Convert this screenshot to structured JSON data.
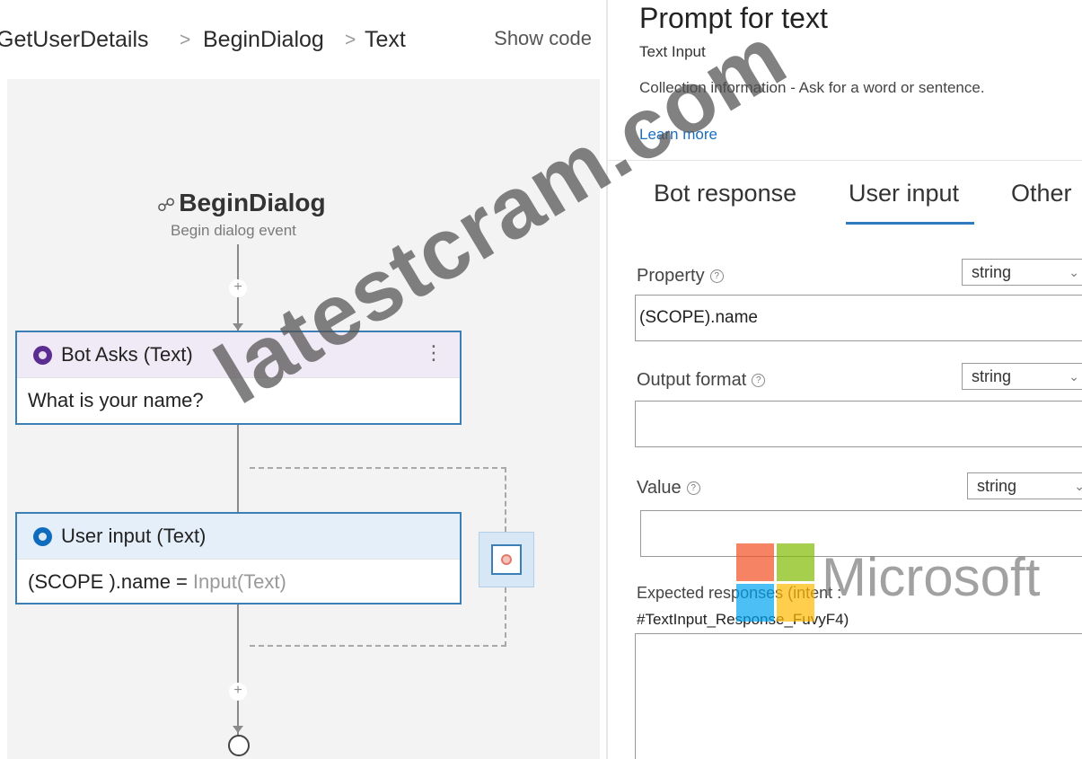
{
  "breadcrumb": {
    "items": [
      "GetUserDetails",
      "BeginDialog",
      "Text"
    ],
    "separator": ">",
    "show_code": "Show code"
  },
  "canvas": {
    "trigger": {
      "title": "BeginDialog",
      "subtitle": "Begin dialog event"
    },
    "add_symbol": "+",
    "bot_asks": {
      "title": "Bot Asks (Text)",
      "body": "What is your name?",
      "menu": "⋮",
      "color": "#5c2d91"
    },
    "user_input": {
      "title": "User input (Text)",
      "body_property": "(SCOPE ).name =",
      "body_value": "Input(Text)",
      "color": "#0f6cbd"
    }
  },
  "panel": {
    "title": "Prompt for text",
    "subtitle": "Text Input",
    "description": "Collection information - Ask for a word or sentence.",
    "learn_more": "Learn more",
    "tabs": [
      {
        "label": "Bot response",
        "active": false
      },
      {
        "label": "User input",
        "active": true
      },
      {
        "label": "Other",
        "active": false
      }
    ],
    "fields": {
      "property": {
        "label": "Property",
        "type": "string",
        "value": "(SCOPE).name"
      },
      "output_format": {
        "label": "Output format",
        "type": "string",
        "value": ""
      },
      "value": {
        "label": "Value",
        "type": "string",
        "value": ""
      },
      "expected": {
        "label": "Expected responses (intent :",
        "label_line2": "#TextInput_Response_FuvyF4)",
        "value": ""
      }
    },
    "accent": "#2f7bbf"
  },
  "watermarks": {
    "text": "latestcram.com",
    "logo_word": "Microsoft",
    "logo_colors": [
      "#f25022",
      "#7fba00",
      "#00a4ef",
      "#ffb900"
    ]
  }
}
